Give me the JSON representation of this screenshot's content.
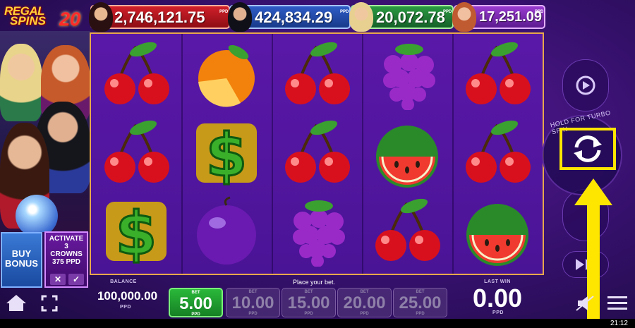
{
  "logo": {
    "line1": "REGAL",
    "line2": "SPINS",
    "number": "20"
  },
  "jackpots": [
    {
      "value": "2,746,121.75",
      "currency": "PPD",
      "color": "#c81a24"
    },
    {
      "value": "424,834.29",
      "currency": "PPD",
      "color": "#2a56c0"
    },
    {
      "value": "20,072.78",
      "currency": "PPD",
      "color": "#2a9a42"
    },
    {
      "value": "17,251.09",
      "currency": "PPD",
      "color": "#8e36c8"
    }
  ],
  "buy_bonus": {
    "line1": "BUY",
    "line2": "BONUS"
  },
  "activate": {
    "line1": "ACTIVATE",
    "line2": "3",
    "line3": "CROWNS",
    "line4": "375 PPD",
    "cancel": "✕",
    "confirm": "✓"
  },
  "reels": [
    [
      "cherry",
      "cherry",
      "dollar"
    ],
    [
      "orange",
      "dollar",
      "plum"
    ],
    [
      "cherry",
      "cherry",
      "grapes"
    ],
    [
      "grapes",
      "watermelon",
      "cherry"
    ],
    [
      "cherry",
      "cherry",
      "watermelon"
    ]
  ],
  "turbo_hint": "HOLD FOR TURBO SPIN",
  "balance": {
    "label": "BALANCE",
    "value": "100,000.00",
    "currency": "PPD"
  },
  "message": "Place your bet.",
  "bets": [
    {
      "label": "BET",
      "value": "5.00",
      "currency": "PPD",
      "selected": true
    },
    {
      "label": "BET",
      "value": "10.00",
      "currency": "PPD",
      "selected": false
    },
    {
      "label": "BET",
      "value": "15.00",
      "currency": "PPD",
      "selected": false
    },
    {
      "label": "BET",
      "value": "20.00",
      "currency": "PPD",
      "selected": false
    },
    {
      "label": "BET",
      "value": "25.00",
      "currency": "PPD",
      "selected": false
    }
  ],
  "last_win": {
    "label": "LAST WIN",
    "value": "0.00",
    "currency": "PPD"
  },
  "status_time": "21:12",
  "icons": [
    "home-icon",
    "fullscreen-icon",
    "autoplay-icon",
    "spin-icon",
    "fast-forward-icon",
    "sound-mute-icon",
    "menu-icon"
  ],
  "colors": {
    "highlight": "#ffe600",
    "reel_border": "#e8a84a",
    "selected_bet": "#22a232"
  }
}
